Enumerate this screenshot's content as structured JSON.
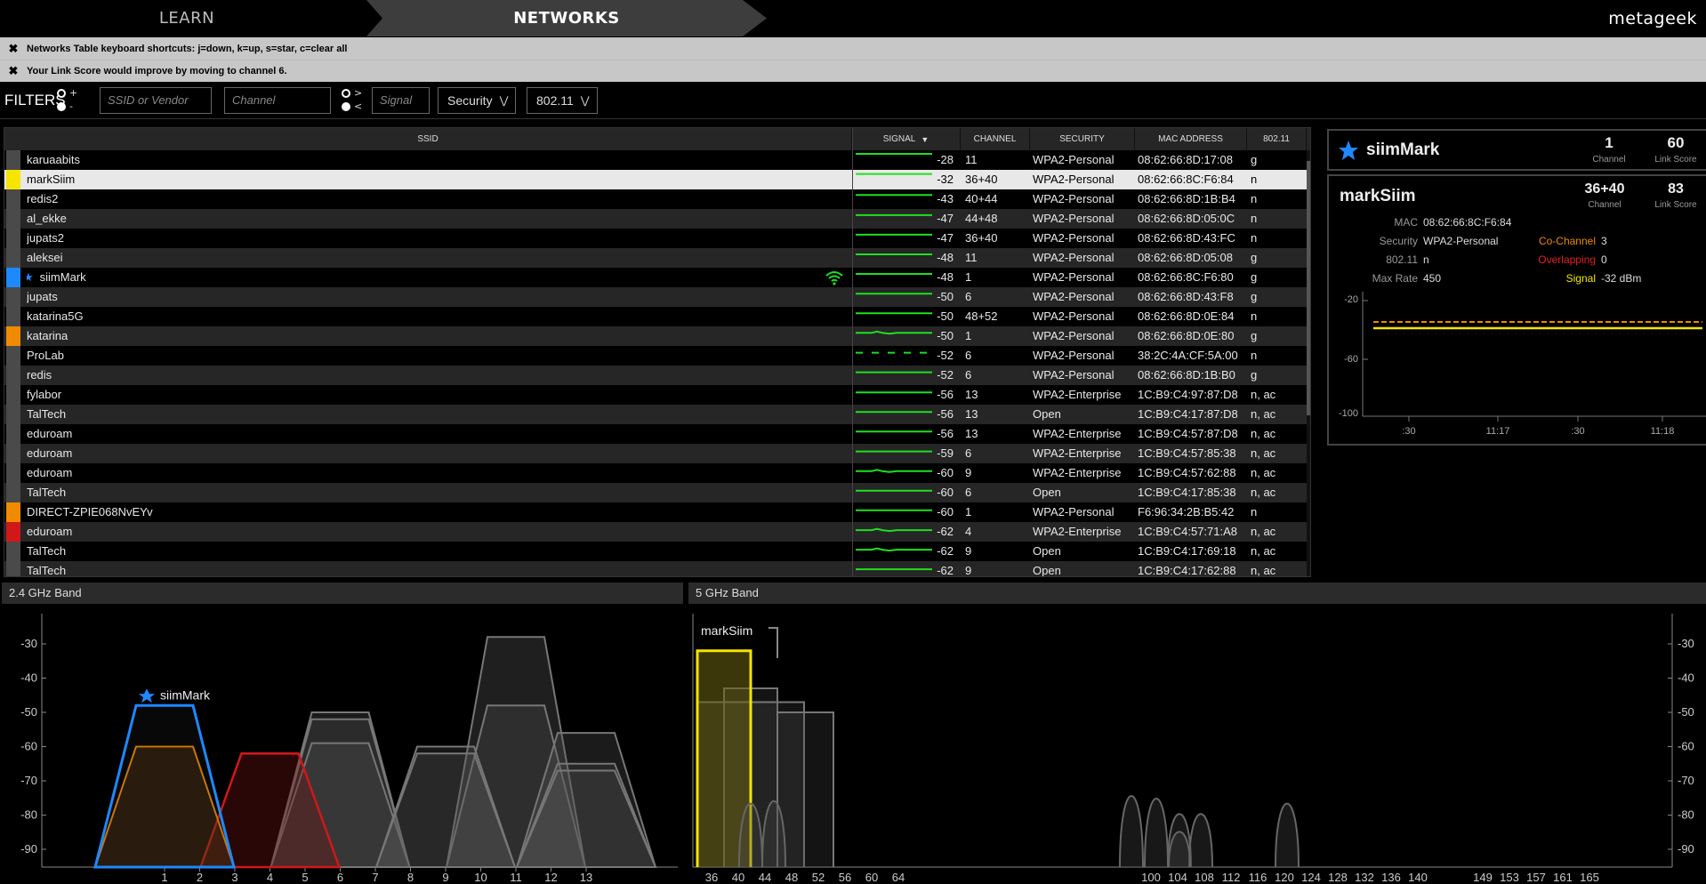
{
  "nav": {
    "learn": "LEARN",
    "networks": "NETWORKS",
    "brand": "metageek"
  },
  "notices": [
    "Networks Table keyboard shortcuts: j=down, k=up, s=star, c=clear all",
    "Your Link Score would improve by moving to channel 6."
  ],
  "filters": {
    "label": "FILTERS",
    "plus": "+",
    "minus": "-",
    "gt": ">",
    "lt": "<",
    "ssid_placeholder": "SSID or Vendor",
    "channel_placeholder": "Channel",
    "signal_placeholder": "Signal",
    "security": "Security",
    "standard": "802.11"
  },
  "table": {
    "headers": {
      "ssid": "SSID",
      "signal": "SIGNAL",
      "channel": "CHANNEL",
      "security": "SECURITY",
      "mac": "MAC ADDRESS",
      "std": "802.11"
    },
    "rows": [
      {
        "ssid": "karuaabits",
        "signal": "-28",
        "channel": "11",
        "security": "WPA2-Personal",
        "mac": "08:62:66:8D:17:08",
        "std": "g",
        "color": "#4a4a4a",
        "spark": "solid"
      },
      {
        "ssid": "markSiim",
        "signal": "-32",
        "channel": "36+40",
        "security": "WPA2-Personal",
        "mac": "08:62:66:8C:F6:84",
        "std": "n",
        "color": "#f5e500",
        "spark": "solid"
      },
      {
        "ssid": "redis2",
        "signal": "-43",
        "channel": "40+44",
        "security": "WPA2-Personal",
        "mac": "08:62:66:8D:1B:B4",
        "std": "n",
        "color": "#4a4a4a",
        "spark": "solid"
      },
      {
        "ssid": "al_ekke",
        "signal": "-47",
        "channel": "44+48",
        "security": "WPA2-Personal",
        "mac": "08:62:66:8D:05:0C",
        "std": "n",
        "color": "#4a4a4a",
        "spark": "solid"
      },
      {
        "ssid": "jupats2",
        "signal": "-47",
        "channel": "36+40",
        "security": "WPA2-Personal",
        "mac": "08:62:66:8D:43:FC",
        "std": "n",
        "color": "#4a4a4a",
        "spark": "solid"
      },
      {
        "ssid": "aleksei",
        "signal": "-48",
        "channel": "11",
        "security": "WPA2-Personal",
        "mac": "08:62:66:8D:05:08",
        "std": "g",
        "color": "#4a4a4a",
        "spark": "solid"
      },
      {
        "ssid": "siimMark",
        "signal": "-48",
        "channel": "1",
        "security": "WPA2-Personal",
        "mac": "08:62:66:8C:F6:80",
        "std": "g",
        "color": "#1e88ff",
        "spark": "solid",
        "starred": true,
        "connected": true
      },
      {
        "ssid": "jupats",
        "signal": "-50",
        "channel": "6",
        "security": "WPA2-Personal",
        "mac": "08:62:66:8D:43:F8",
        "std": "g",
        "color": "#4a4a4a",
        "spark": "solid"
      },
      {
        "ssid": "katarina5G",
        "signal": "-50",
        "channel": "48+52",
        "security": "WPA2-Personal",
        "mac": "08:62:66:8D:0E:84",
        "std": "n",
        "color": "#4a4a4a",
        "spark": "solid"
      },
      {
        "ssid": "katarina",
        "signal": "-50",
        "channel": "1",
        "security": "WPA2-Personal",
        "mac": "08:62:66:8D:0E:80",
        "std": "g",
        "color": "#f08a00",
        "spark": "wavy"
      },
      {
        "ssid": "ProLab",
        "signal": "-52",
        "channel": "6",
        "security": "WPA2-Personal",
        "mac": "38:2C:4A:CF:5A:00",
        "std": "n",
        "color": "#4a4a4a",
        "spark": "dashed"
      },
      {
        "ssid": "redis",
        "signal": "-52",
        "channel": "6",
        "security": "WPA2-Personal",
        "mac": "08:62:66:8D:1B:B0",
        "std": "g",
        "color": "#4a4a4a",
        "spark": "solid"
      },
      {
        "ssid": "fylabor",
        "signal": "-56",
        "channel": "13",
        "security": "WPA2-Enterprise",
        "mac": "1C:B9:C4:97:87:D8",
        "std": "n, ac",
        "color": "#4a4a4a",
        "spark": "solid"
      },
      {
        "ssid": "TalTech",
        "signal": "-56",
        "channel": "13",
        "security": "Open",
        "mac": "1C:B9:C4:17:87:D8",
        "std": "n, ac",
        "color": "#4a4a4a",
        "spark": "solid"
      },
      {
        "ssid": "eduroam",
        "signal": "-56",
        "channel": "13",
        "security": "WPA2-Enterprise",
        "mac": "1C:B9:C4:57:87:D8",
        "std": "n, ac",
        "color": "#4a4a4a",
        "spark": "solid"
      },
      {
        "ssid": "eduroam",
        "signal": "-59",
        "channel": "6",
        "security": "WPA2-Enterprise",
        "mac": "1C:B9:C4:57:85:38",
        "std": "n, ac",
        "color": "#4a4a4a",
        "spark": "solid"
      },
      {
        "ssid": "eduroam",
        "signal": "-60",
        "channel": "9",
        "security": "WPA2-Enterprise",
        "mac": "1C:B9:C4:57:62:88",
        "std": "n, ac",
        "color": "#4a4a4a",
        "spark": "wavy"
      },
      {
        "ssid": "TalTech",
        "signal": "-60",
        "channel": "6",
        "security": "Open",
        "mac": "1C:B9:C4:17:85:38",
        "std": "n, ac",
        "color": "#4a4a4a",
        "spark": "solid"
      },
      {
        "ssid": "DIRECT-ZPIE068NvEYv",
        "signal": "-60",
        "channel": "1",
        "security": "WPA2-Personal",
        "mac": "F6:96:34:2B:B5:42",
        "std": "n",
        "color": "#f08a00",
        "spark": "solid"
      },
      {
        "ssid": "eduroam",
        "signal": "-62",
        "channel": "4",
        "security": "WPA2-Enterprise",
        "mac": "1C:B9:C4:57:71:A8",
        "std": "n, ac",
        "color": "#d01818",
        "spark": "wavy"
      },
      {
        "ssid": "TalTech",
        "signal": "-62",
        "channel": "9",
        "security": "Open",
        "mac": "1C:B9:C4:17:69:18",
        "std": "n, ac",
        "color": "#4a4a4a",
        "spark": "wavy"
      },
      {
        "ssid": "TalTech",
        "signal": "-62",
        "channel": "9",
        "security": "Open",
        "mac": "1C:B9:C4:17:62:88",
        "std": "n, ac",
        "color": "#4a4a4a",
        "spark": "solid"
      }
    ]
  },
  "summary": {
    "ssid": "siimMark",
    "channel": "1",
    "channel_label": "Channel",
    "link_score": "60",
    "link_label": "Link Score"
  },
  "details": {
    "ssid": "markSiim",
    "channel": "36+40",
    "channel_label": "Channel",
    "link_score": "83",
    "link_label": "Link Score",
    "mac_label": "MAC",
    "mac": "08:62:66:8C:F6:84",
    "security_label": "Security",
    "security": "WPA2-Personal",
    "std_label": "802.11",
    "std": "n",
    "maxrate_label": "Max Rate",
    "maxrate": "450",
    "cochannel_label": "Co-Channel",
    "cochannel": "3",
    "overlap_label": "Overlapping",
    "overlap": "0",
    "signal_label": "Signal",
    "signal": "-32 dBm",
    "chart": {
      "y_ticks": [
        "-20",
        "-60",
        "-100"
      ],
      "x_ticks": [
        ":30",
        "11:17",
        ":30",
        "11:18"
      ]
    }
  },
  "band24": {
    "title": "2.4 GHz Band",
    "y_ticks": [
      "-30",
      "-40",
      "-50",
      "-60",
      "-70",
      "-80",
      "-90"
    ],
    "x_ticks": [
      "1",
      "2",
      "3",
      "4",
      "5",
      "6",
      "7",
      "8",
      "9",
      "10",
      "11",
      "12",
      "13"
    ],
    "labels": {
      "starred": "siimMark"
    }
  },
  "band5": {
    "title": "5 GHz Band",
    "y_ticks": [
      "-30",
      "-40",
      "-50",
      "-60",
      "-70",
      "-80",
      "-90"
    ],
    "x_ticks": [
      "36",
      "40",
      "44",
      "48",
      "52",
      "56",
      "60",
      "64",
      "100",
      "104",
      "108",
      "112",
      "116",
      "120",
      "124",
      "128",
      "132",
      "136",
      "140",
      "149",
      "153",
      "157",
      "161",
      "165"
    ],
    "labels": {
      "selected": "markSiim"
    }
  },
  "colors": {
    "accent_blue": "#1e88ff",
    "selected_yellow": "#f5e500",
    "orange": "#f08a00",
    "red": "#d01818",
    "spark_green": "#1ee01e"
  }
}
